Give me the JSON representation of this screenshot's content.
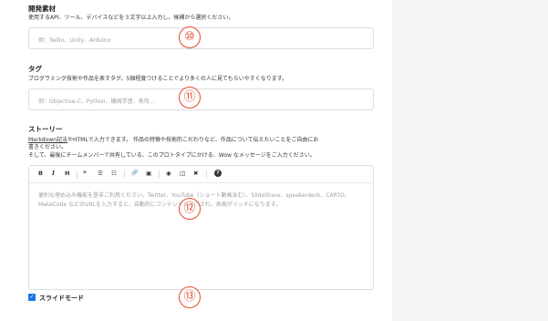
{
  "materials": {
    "label": "開発素材",
    "description": "使用するAPI、ツール、デバイスなどを３文字以上入力し、候補から選択ください。",
    "placeholder": "例：Twilio、Unity、Arduino",
    "marker": "⑩"
  },
  "tags": {
    "label": "タグ",
    "description": "プログラミング技術や作品を表すタグ。5個程度つけることでより多くの人に見てもらいやすくなります。",
    "placeholder": "例：Objective-C、Python、機械学習、寿司...",
    "marker": "⑪"
  },
  "story": {
    "label": "ストーリー",
    "description_link": "Markdown記法",
    "description_line1_rest": "やHTMLで入力できます。 作品の特徴や技術的こだわりなど、作品について伝えたいことをご自由にお",
    "description_line2": "書きください。",
    "description_line3": "そして、最後にチームメンバーで共有している、このプロトタイプにかける、Wow なメッセージをご入力ください。",
    "toolbar": {
      "bold": "B",
      "italic": "I",
      "heading": "H",
      "quote": "❝",
      "ul": "☰",
      "ol": "☷",
      "link": "🔗",
      "image": "▣",
      "preview": "◉",
      "side_by_side": "◫",
      "fullscreen": "✖",
      "guide": "?"
    },
    "editor_placeholder": "便利な埋め込み機能を是非ご利用ください。Twitter、YouTube（ショート動画含む）、SlideShare、speakerdeck、CARTO、MakeCode などのURLを入力すると、自動的にコンテンツが表示され、表現がリッチになります。",
    "marker": "⑫"
  },
  "slide_mode": {
    "label": "スライドモード",
    "checked": "✓",
    "marker": "⑬"
  },
  "colors": {
    "marker": "#e04a2a",
    "checkbox": "#1a73e8"
  }
}
